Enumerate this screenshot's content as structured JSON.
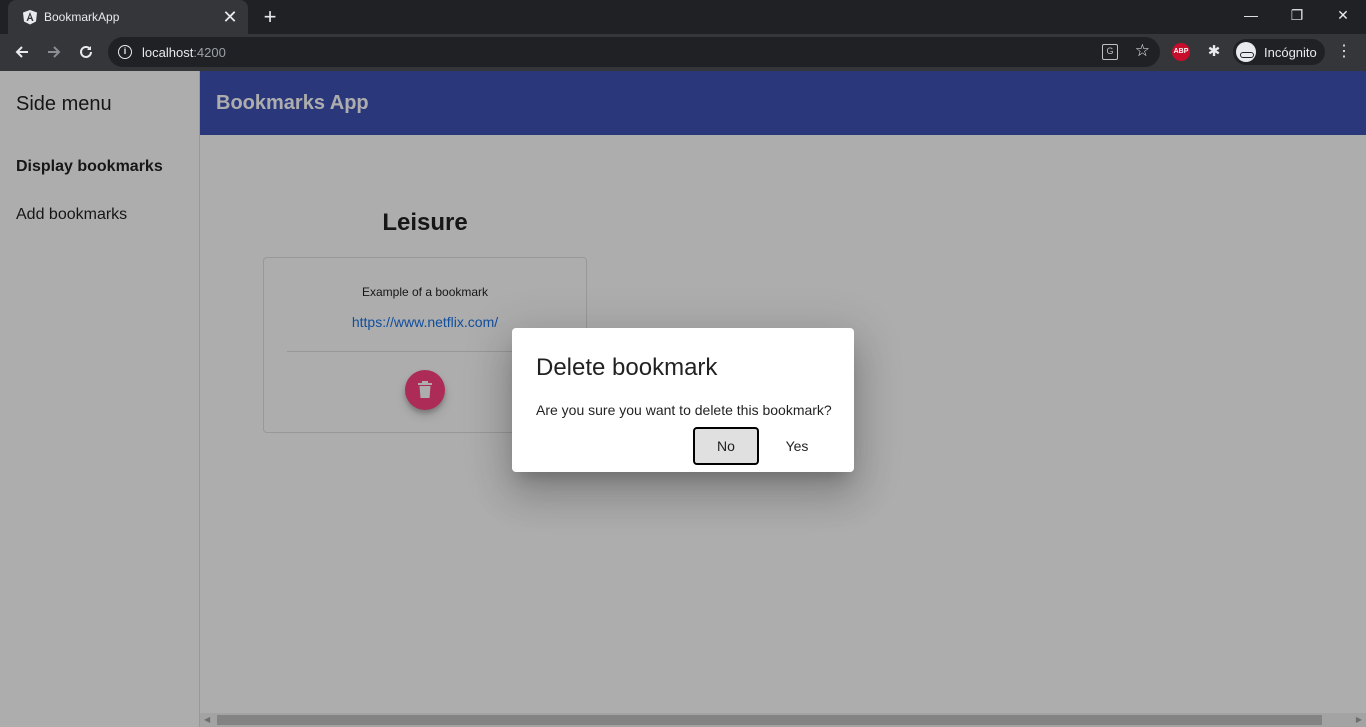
{
  "browser": {
    "tab_title": "BookmarkApp",
    "close_glyph": "✕",
    "newtab_glyph": "+",
    "url_host": "localhost",
    "url_port": ":4200",
    "profile_label": "Incógnito",
    "extension_label": "ABP",
    "window_controls": {
      "minimize": "—",
      "restore": "❐",
      "close": "✕"
    }
  },
  "sidenav": {
    "title": "Side menu",
    "items": [
      {
        "label": "Display bookmarks",
        "active": true
      },
      {
        "label": "Add bookmarks",
        "active": false
      }
    ]
  },
  "header": {
    "title": "Bookmarks App",
    "color": "#3f51b5"
  },
  "main": {
    "category_title": "Leisure",
    "bookmarks": [
      {
        "description": "Example of a bookmark",
        "url": "https://www.netflix.com/"
      }
    ],
    "delete_button_color": "#ff4081"
  },
  "dialog": {
    "title": "Delete bookmark",
    "message": "Are you sure you want to delete this bookmark?",
    "no_label": "No",
    "yes_label": "Yes"
  },
  "icons": {
    "back": "back-icon",
    "forward": "forward-icon",
    "reload": "reload-icon",
    "delete": "trash-icon"
  }
}
